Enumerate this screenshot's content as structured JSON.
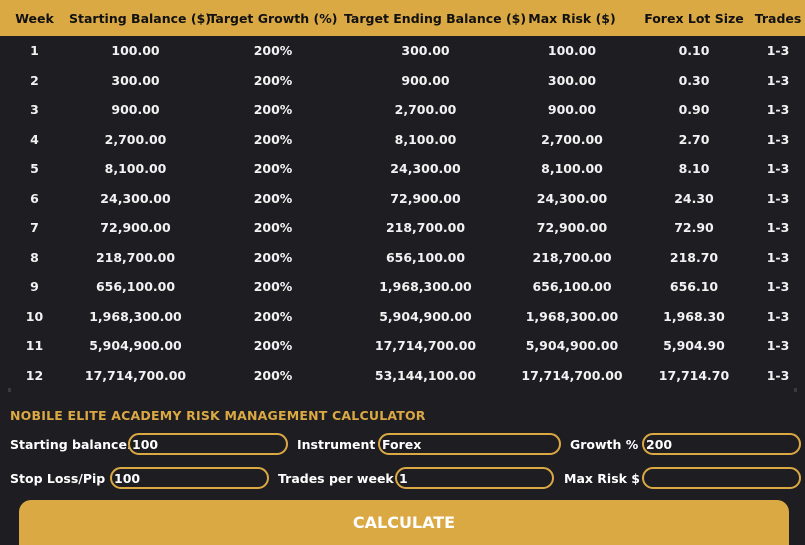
{
  "table": {
    "headers": [
      "Week",
      "Starting Balance ($)",
      "Target Growth (%)",
      "Target Ending Balance ($)",
      "Max Risk ($)",
      "Forex Lot Size",
      "Trades"
    ],
    "rows": [
      [
        "1",
        "100.00",
        "200%",
        "300.00",
        "100.00",
        "0.10",
        "1-3"
      ],
      [
        "2",
        "300.00",
        "200%",
        "900.00",
        "300.00",
        "0.30",
        "1-3"
      ],
      [
        "3",
        "900.00",
        "200%",
        "2,700.00",
        "900.00",
        "0.90",
        "1-3"
      ],
      [
        "4",
        "2,700.00",
        "200%",
        "8,100.00",
        "2,700.00",
        "2.70",
        "1-3"
      ],
      [
        "5",
        "8,100.00",
        "200%",
        "24,300.00",
        "8,100.00",
        "8.10",
        "1-3"
      ],
      [
        "6",
        "24,300.00",
        "200%",
        "72,900.00",
        "24,300.00",
        "24.30",
        "1-3"
      ],
      [
        "7",
        "72,900.00",
        "200%",
        "218,700.00",
        "72,900.00",
        "72.90",
        "1-3"
      ],
      [
        "8",
        "218,700.00",
        "200%",
        "656,100.00",
        "218,700.00",
        "218.70",
        "1-3"
      ],
      [
        "9",
        "656,100.00",
        "200%",
        "1,968,300.00",
        "656,100.00",
        "656.10",
        "1-3"
      ],
      [
        "10",
        "1,968,300.00",
        "200%",
        "5,904,900.00",
        "1,968,300.00",
        "1,968.30",
        "1-3"
      ],
      [
        "11",
        "5,904,900.00",
        "200%",
        "17,714,700.00",
        "5,904,900.00",
        "5,904.90",
        "1-3"
      ],
      [
        "12",
        "17,714,700.00",
        "200%",
        "53,144,100.00",
        "17,714,700.00",
        "17,714.70",
        "1-3"
      ]
    ]
  },
  "calculator": {
    "title": "NOBILE ELITE ACADEMY RISK MANAGEMENT CALCULATOR",
    "starting_balance_label": "Starting balance:",
    "starting_balance_value": "100",
    "instrument_label": "Instrument",
    "instrument_value": "Forex",
    "growth_label": "Growth %",
    "growth_value": "200",
    "stop_loss_label": "Stop Loss/Pip",
    "stop_loss_value": "100",
    "trades_label": "Trades per week",
    "trades_value": "1",
    "max_risk_label": "Max Risk $",
    "max_risk_value": "",
    "calculate_label": "CALCULATE"
  },
  "colors": {
    "accent": "#dba944",
    "background": "#1e1d22",
    "text": "#ffffff"
  }
}
